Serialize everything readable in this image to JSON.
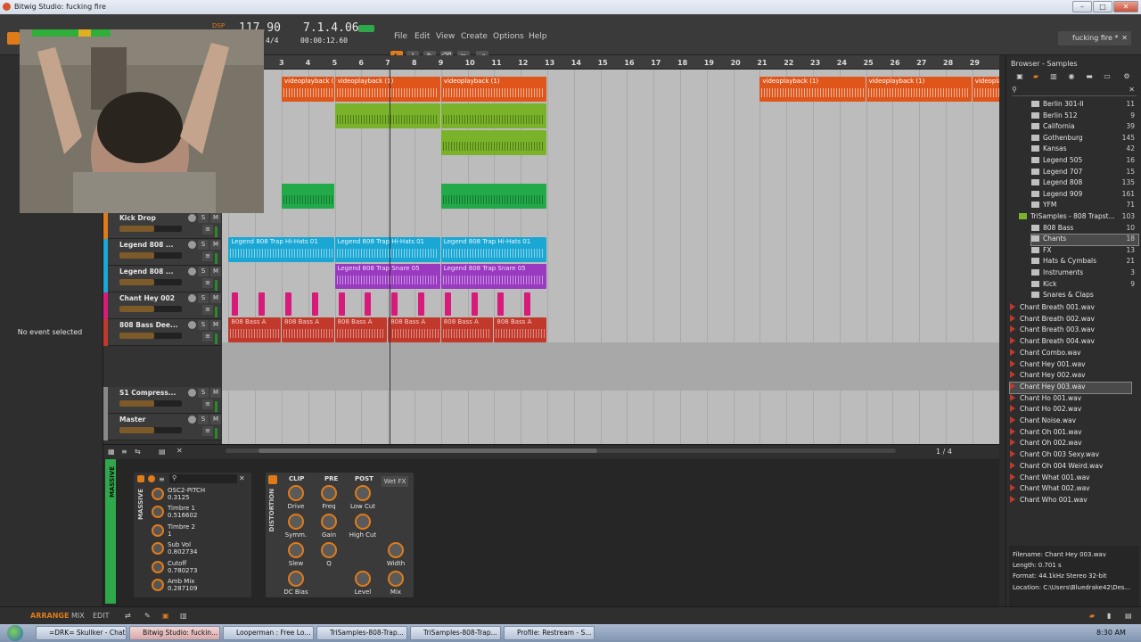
{
  "window": {
    "title": "Bitwig Studio: fucking fire",
    "buttons": [
      "–",
      "□",
      "✕"
    ]
  },
  "menu": [
    "File",
    "Edit",
    "View",
    "Create",
    "Options",
    "Help"
  ],
  "transport": {
    "dsp_label": "DSP",
    "tempo": "117.90",
    "time_sig": "4/4",
    "position": "7.1.4.06",
    "time": "00:00:12.60"
  },
  "project_tab": "fucking fire *",
  "left_panel": {
    "message": "No event selected"
  },
  "tracks": [
    {
      "name": "Kick Drop",
      "color": "#e07b1a"
    },
    {
      "name": "Legend 808 ...",
      "color": "#1aa7d4"
    },
    {
      "name": "Legend 808 ...",
      "color": "#1aa7d4"
    },
    {
      "name": "Chant Hey 002",
      "color": "#d81b7a"
    },
    {
      "name": "808 Bass Dee...",
      "color": "#c0392b"
    },
    {
      "name": "S1 Compress...",
      "color": "#888888"
    },
    {
      "name": "Master",
      "color": "#888888"
    }
  ],
  "ruler": [
    "3",
    "4",
    "5",
    "6",
    "7",
    "8",
    "9",
    "10",
    "11",
    "12",
    "13",
    "14",
    "15",
    "16",
    "17",
    "18",
    "19",
    "20",
    "21",
    "22",
    "23",
    "24",
    "25",
    "26",
    "27",
    "28",
    "29"
  ],
  "clips": {
    "video_label": "videoplayback (1)",
    "hihat_label": "Legend 808 Trap Hi-Hats 01",
    "snare_label": "Legend 808 Trap Snare 05",
    "bass_label": "808 Bass A"
  },
  "page_indicator": "1 / 4",
  "browser": {
    "title": "Browser - Samples",
    "search_placeholder": "",
    "folders": [
      {
        "name": "Berlin 301-II",
        "count": "11"
      },
      {
        "name": "Berlin 512",
        "count": "9"
      },
      {
        "name": "California",
        "count": "39"
      },
      {
        "name": "Gothenburg",
        "count": "145"
      },
      {
        "name": "Kansas",
        "count": "42"
      },
      {
        "name": "Legend 505",
        "count": "16"
      },
      {
        "name": "Legend 707",
        "count": "15"
      },
      {
        "name": "Legend 808",
        "count": "135"
      },
      {
        "name": "Legend 909",
        "count": "161"
      },
      {
        "name": "YFM",
        "count": "71"
      },
      {
        "name": "TriSamples - 808 Trapst...",
        "count": "103"
      },
      {
        "name": "808 Bass",
        "count": "10"
      },
      {
        "name": "Chants",
        "count": "18"
      },
      {
        "name": "FX",
        "count": "13"
      },
      {
        "name": "Hats & Cymbals",
        "count": "21"
      },
      {
        "name": "Instruments",
        "count": "3"
      },
      {
        "name": "Kick",
        "count": "9"
      },
      {
        "name": "Snares & Claps",
        "count": ""
      }
    ],
    "files": [
      "Chant Breath 001.wav",
      "Chant Breath 002.wav",
      "Chant Breath 003.wav",
      "Chant Breath 004.wav",
      "Chant Combo.wav",
      "Chant Hey 001.wav",
      "Chant Hey 002.wav",
      "Chant Hey 003.wav",
      "Chant Ho 001.wav",
      "Chant Ho 002.wav",
      "Chant Noise.wav",
      "Chant Oh 001.wav",
      "Chant Oh 002.wav",
      "Chant Oh 003 Sexy.wav",
      "Chant Oh 004 Weird.wav",
      "Chant What 001.wav",
      "Chant What 002.wav",
      "Chant Who 001.wav"
    ],
    "info": {
      "filename": "Filename: Chant Hey 003.wav",
      "length": "Length: 0.701 s",
      "format": "Format: 44.1kHz Stereo 32-bit",
      "location": "Location: C:\\Users\\Bluedrake42\\Des..."
    }
  },
  "device": {
    "massive_label": "MASSIVE",
    "params": [
      {
        "name": "OSC2-PITCH",
        "value": "0.3125"
      },
      {
        "name": "Timbre 1",
        "value": "0.516602"
      },
      {
        "name": "Timbre 2",
        "value": "1"
      },
      {
        "name": "Sub Vol",
        "value": "0.802734"
      },
      {
        "name": "Cutoff",
        "value": "0.780273"
      },
      {
        "name": "Amb Mix",
        "value": "0.287109"
      }
    ],
    "distortion_label": "DISTORTION",
    "sections": [
      "CLIP",
      "PRE",
      "POST"
    ],
    "wet_fx": "Wet FX",
    "knobs": [
      "Drive",
      "Freq",
      "Low Cut",
      "Symm.",
      "Gain",
      "High Cut",
      "Slew",
      "Q",
      "Width",
      "DC Bias",
      "Level",
      "Mix"
    ]
  },
  "status_tabs": [
    "ARRANGE",
    "MIX",
    "EDIT"
  ],
  "taskbar": {
    "items": [
      "=DRK= Skullker - Chat",
      "Bitwig Studio: fuckin...",
      "Looperman : Free Lo...",
      "TriSamples-808-Trap...",
      "TriSamples-808-Trap...",
      "Profile: Restream - S..."
    ],
    "clock": "8:30 AM"
  }
}
